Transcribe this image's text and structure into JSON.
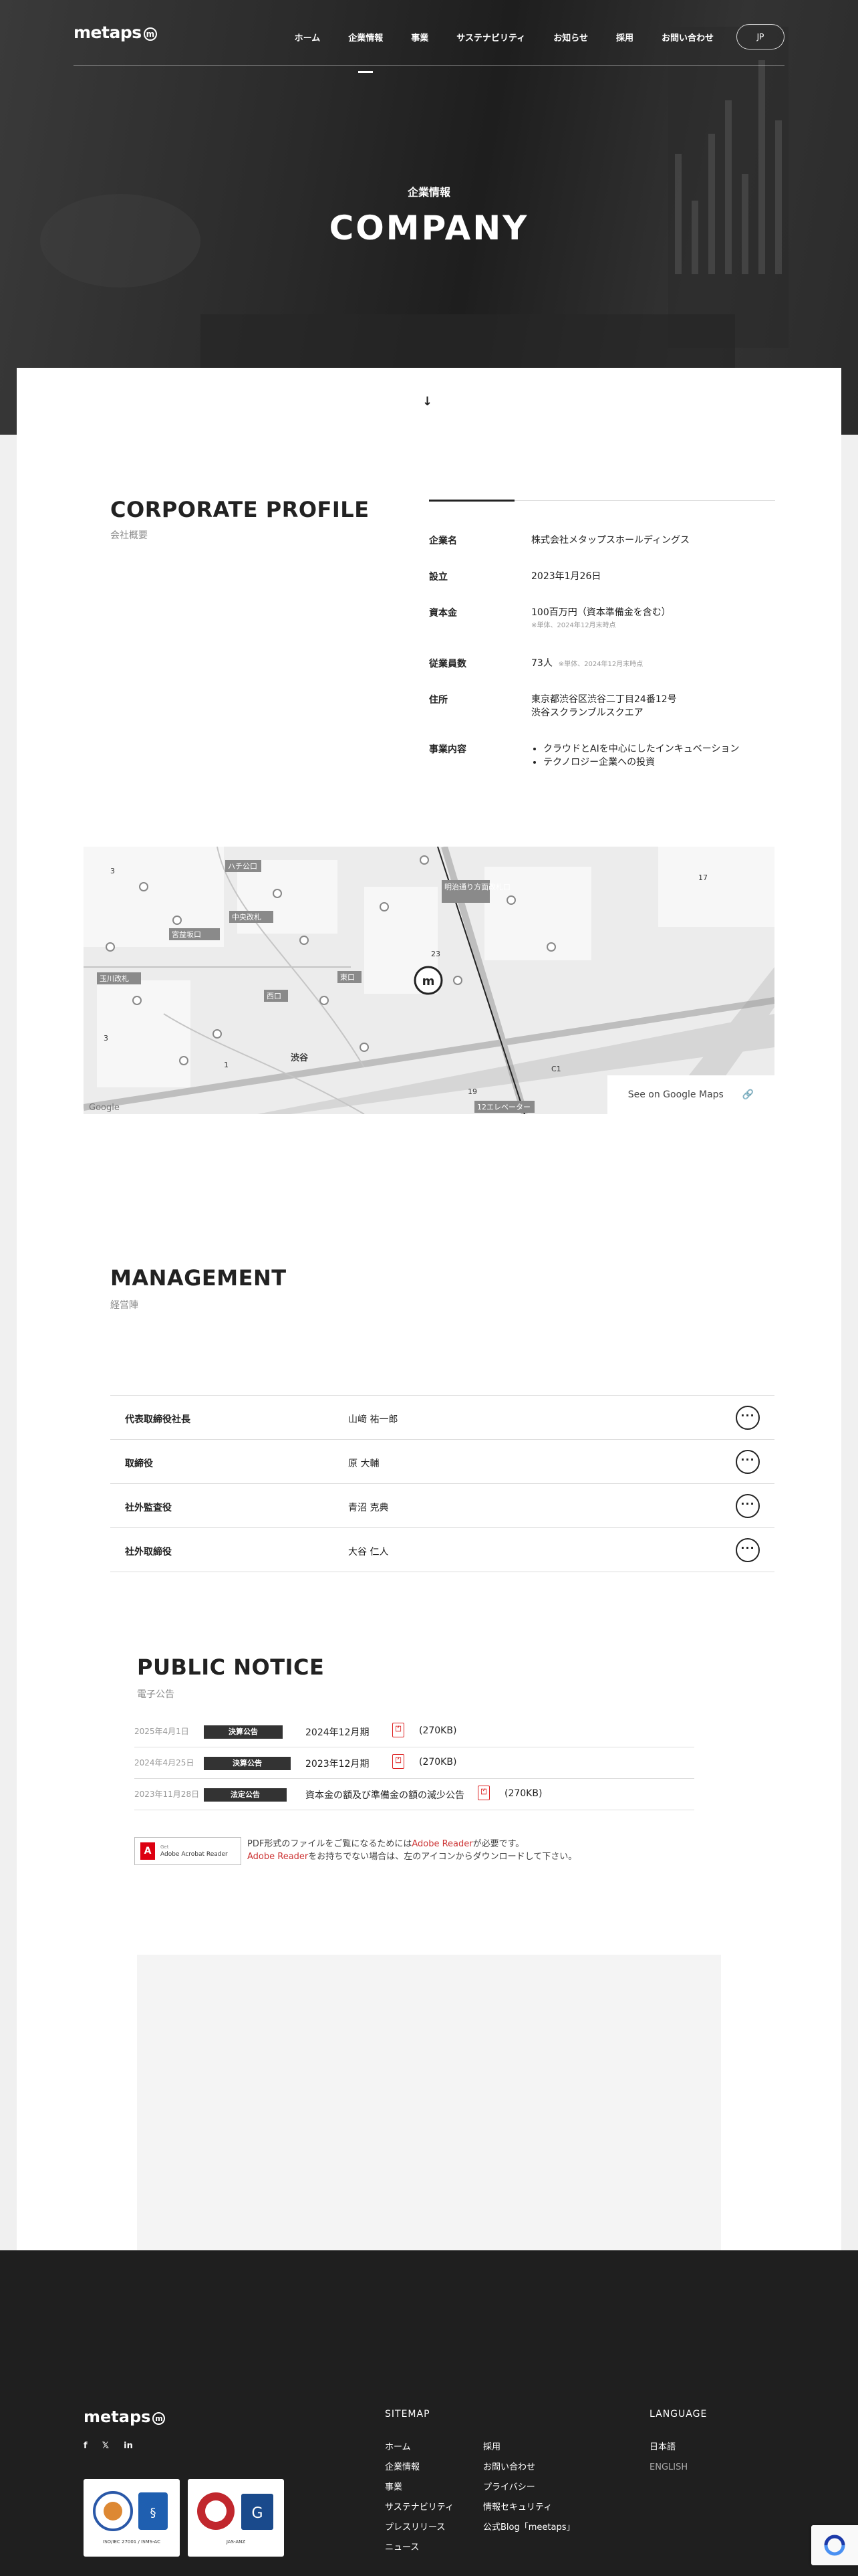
{
  "header": {
    "logo": "metaps",
    "logo_badge": "m",
    "nav": [
      "ホーム",
      "企業情報",
      "事業",
      "サステナビリティ",
      "お知らせ",
      "採用",
      "お問い合わせ"
    ],
    "active_nav": "企業情報",
    "lang_button": "JP"
  },
  "hero": {
    "subtitle": "企業情報",
    "title": "COMPANY"
  },
  "scroll_icon": "down-arrow-icon",
  "profile": {
    "title": "CORPORATE PROFILE",
    "subtitle": "会社概要",
    "rows": [
      {
        "label": "企業名",
        "value": "株式会社メタップスホールディングス"
      },
      {
        "label": "設立",
        "value": "2023年1月26日"
      },
      {
        "label": "資本金",
        "value": "100百万円（資本準備金を含む）",
        "note": "※単体、2024年12月末時点"
      },
      {
        "label": "従業員数",
        "value": "73人",
        "note": "※単体、2024年12月末時点"
      },
      {
        "label": "住所",
        "value": "東京都渋谷区渋谷二丁目24番12号",
        "value2": "渋谷スクランブルスクエア"
      },
      {
        "label": "事業内容",
        "items": [
          "クラウドとAIを中心にしたインキュベーション",
          "テクノロジー企業への投資"
        ]
      }
    ]
  },
  "map": {
    "labels": [
      "ハチ公口",
      "宮益坂口",
      "明治通り方面改札口",
      "渋谷",
      "玉川改札",
      "中央改札",
      "西口",
      "東口",
      "12エレベーター",
      "C1",
      "Google"
    ],
    "google_maps_link": "See on Google Maps"
  },
  "management": {
    "title": "MANAGEMENT",
    "subtitle": "経営陣",
    "members": [
      {
        "role": "代表取締役社長",
        "name": "山﨑 祐一郎"
      },
      {
        "role": "取締役",
        "name": "原 大輔"
      },
      {
        "role": "社外監査役",
        "name": "青沼 克典"
      },
      {
        "role": "社外取締役",
        "name": "大谷 仁人"
      }
    ]
  },
  "notice": {
    "title": "PUBLIC NOTICE",
    "subtitle": "電子公告",
    "items": [
      {
        "date": "2025年4月1日",
        "tag": "決算公告",
        "title": "2024年12月期",
        "size": "(270KB)"
      },
      {
        "date": "2024年4月25日",
        "tag": "決算公告",
        "title": "2023年12月期",
        "size": "(270KB)"
      },
      {
        "date": "2023年11月28日",
        "tag": "法定公告",
        "title": "資本金の額及び準備金の額の減少公告",
        "size": "(270KB)"
      }
    ],
    "adobe_badge_line1": "Get",
    "adobe_badge_line2": "Adobe Acrobat Reader",
    "adobe_note_1a": "PDF形式のファイルをご覧になるためには",
    "adobe_note_1b": "Adobe Reader",
    "adobe_note_1c": "が必要です。",
    "adobe_note_2a": "Adobe Reader",
    "adobe_note_2b": "をお持ちでない場合は、左のアイコンからダウンロードして下さい。"
  },
  "footer": {
    "logo": "metaps",
    "social": [
      "f",
      "𝕏",
      "in"
    ],
    "sitemap_title": "SITEMAP",
    "sitemap_col1": [
      "ホーム",
      "企業情報",
      "事業",
      "サステナビリティ",
      "プレスリリース",
      "ニュース"
    ],
    "sitemap_col2": [
      "採用",
      "お問い合わせ",
      "プライバシー",
      "情報セキュリティ",
      "公式Blog「meetaps」"
    ],
    "language_title": "LANGUAGE",
    "languages": [
      "日本語",
      "ENGLISH"
    ],
    "badge1_caption": "ISO/IEC 27001 / ISMS-AC",
    "badge2_caption": "JAS-ANZ"
  }
}
